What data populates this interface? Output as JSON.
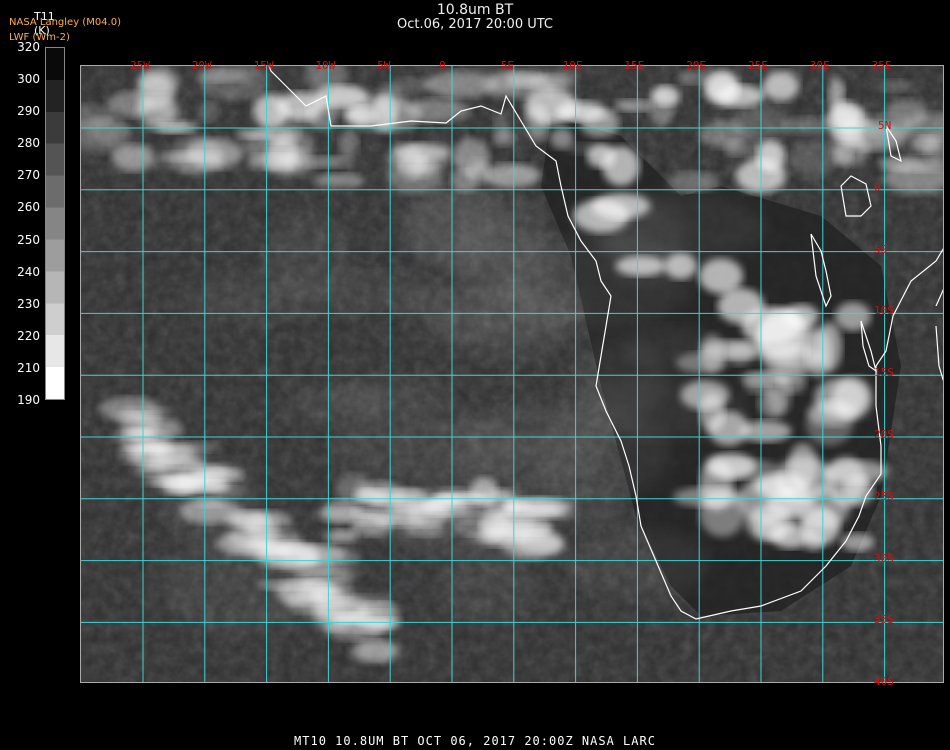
{
  "header": {
    "title": "10.8um BT",
    "datetime": "Oct.06, 2017 20:00 UTC",
    "source": "NASA Langley (M04.0)",
    "lwf": "LWF (Wm-2)"
  },
  "colorbar": {
    "label": "T11",
    "unit": "(K)",
    "ticks": [
      "320",
      "300",
      "290",
      "280",
      "270",
      "260",
      "250",
      "240",
      "230",
      "220",
      "210",
      "190"
    ]
  },
  "map": {
    "lon_labels": [
      "25W",
      "20W",
      "15W",
      "10W",
      "5W",
      "0",
      "5E",
      "10E",
      "15E",
      "20E",
      "25E",
      "30E",
      "35E"
    ],
    "lat_labels": [
      "5N",
      "0",
      "5S",
      "10S",
      "15S",
      "20S",
      "25S",
      "30S",
      "35S",
      "40S"
    ],
    "grid_color": "#3fd3d3",
    "label_color": "#cc1111",
    "coast_color": "#ffffff"
  },
  "footer": {
    "text": "MT10  10.8UM BT   OCT 06, 2017 20:00Z   NASA LARC"
  }
}
